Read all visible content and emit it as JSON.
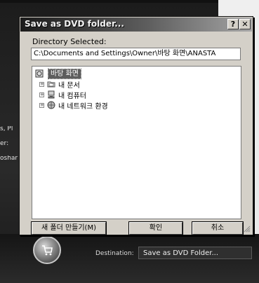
{
  "background": {
    "left_texts": [
      "s, Pl",
      "er:",
      "oshar"
    ],
    "destination_label": "Destination:",
    "destination_value": "Save as DVD Folder..."
  },
  "dialog": {
    "title": "Save as DVD folder...",
    "help_glyph": "?",
    "close_glyph": "✕",
    "directory_label": "Directory Selected:",
    "directory_value": "C:\\Documents and Settings\\Owner\\바탕 화면\\ANASTA",
    "tree": {
      "root": {
        "label": "바탕 화면",
        "icon": "desktop-icon"
      },
      "items": [
        {
          "label": "내 문서",
          "icon": "documents-folder-icon"
        },
        {
          "label": "내 컴퓨터",
          "icon": "computer-icon"
        },
        {
          "label": "내 네트워크 환경",
          "icon": "network-icon"
        }
      ]
    },
    "buttons": {
      "new_folder": "새 폴더 만들기(M)",
      "ok": "확인",
      "cancel": "취소"
    }
  },
  "colors": {
    "dialog_bg": "#d4d0c8",
    "selection": "#5d5d5d"
  }
}
